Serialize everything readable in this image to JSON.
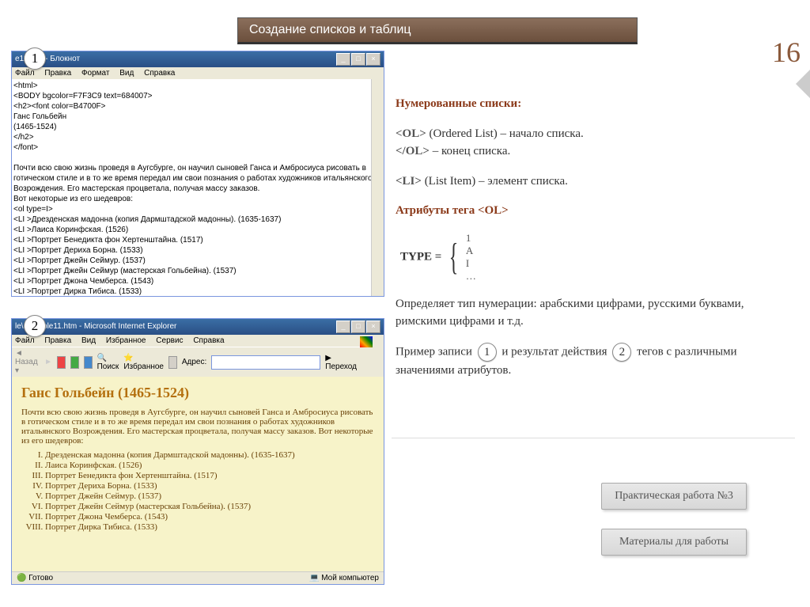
{
  "slide": {
    "title": "Создание списков и таблиц",
    "number": "16"
  },
  "badges": {
    "one": "1",
    "two": "2"
  },
  "notepad": {
    "title": "e11.htm - Блокнот",
    "menu": [
      "Файл",
      "Правка",
      "Формат",
      "Вид",
      "Справка"
    ],
    "code": "<html>\n<BODY bgcolor=F7F3C9 text=684007>\n<h2><font color=B4700F>\nГанс Гольбейн\n(1465-1524)\n</h2>\n</font>\n\nПочти всю свою жизнь проведя в Аугсбурге, он научил сыновей Ганса и Амбросиуса рисовать в готическом стиле и в то же время передал им свои познания о работах художников итальянского Возрождения. Его мастерская процветала, получая массу заказов.\nВот некоторые из его шедевров:\n<ol type=I>\n<LI >Дрезденская мадонна (копия Дармштадской мадонны). (1635-1637)\n<LI >Лаиса Коринфская. (1526)\n<LI >Портрет Бенедикта фон Хертенштайна. (1517)\n<LI >Портрет Дериха Борна. (1533)\n<LI >Портрет Джейн Сеймур. (1537)\n<LI >Портрет Джейн Сеймур (мастерская Гольбейна). (1537)\n<LI >Портрет Джона Чемберса. (1543)\n<LI >Портрет Дирка Тибиса. (1533)\n</ol>\n</BODY>\n</HTML>"
  },
  "ie": {
    "title": "le\\example11.htm - Microsoft Internet Explorer",
    "menu": [
      "Файл",
      "Правка",
      "Вид",
      "Избранное",
      "Сервис",
      "Справка"
    ],
    "toolbar": {
      "back": "Назад",
      "search": "Поиск",
      "fav": "Избранное",
      "addr": "Адрес:",
      "go": "Переход"
    },
    "heading": "Ганс Гольбейн (1465-1524)",
    "para": "Почти всю свою жизнь проведя в Аугсбурге, он научил сыновей Ганса и Амбросиуса рисовать в готическом стиле и в то же время передал им свои познания о работах художников итальянского Возрождения. Его мастерская процветала, получая массу заказов. Вот некоторые из его шедевров:",
    "items": [
      "Дрезденская мадонна (копия Дармштадской мадонны). (1635-1637)",
      "Лаиса Коринфская. (1526)",
      "Портрет Бенедикта фон Хертенштайна. (1517)",
      "Портрет Дериха Борна. (1533)",
      "Портрет Джейн Сеймур. (1537)",
      "Портрет Джейн Сеймур (мастерская Гольбейна). (1537)",
      "Портрет Джона Чемберса. (1543)",
      "Портрет Дирка Тибиса. (1533)"
    ],
    "status": {
      "ready": "Готово",
      "comp": "Мой компьютер"
    }
  },
  "content": {
    "h1": "Нумерованные списки:",
    "ol_tag": "<OL>",
    "ol_def": "(Ordered List) – начало списка.",
    "ol_close": "</OL>",
    "ol_close_def": " – конец списка.",
    "li_tag": "<LI>",
    "li_def": "(List Item) – элемент списка.",
    "attr": "Атрибуты тега  <OL>",
    "type_lbl": "TYPE =",
    "type_opts": [
      "1",
      "A",
      "I",
      "…"
    ],
    "desc": "Определяет тип нумерации: арабскими цифрами, русскими буквами, римскими цифрами и т.д.",
    "ex_a": "Пример записи",
    "ex_b": "и результат действия",
    "ex_c": "тегов с различными значениями атрибутов."
  },
  "buttons": {
    "practice": "Практическая работа №3",
    "materials": "Материалы для работы"
  }
}
